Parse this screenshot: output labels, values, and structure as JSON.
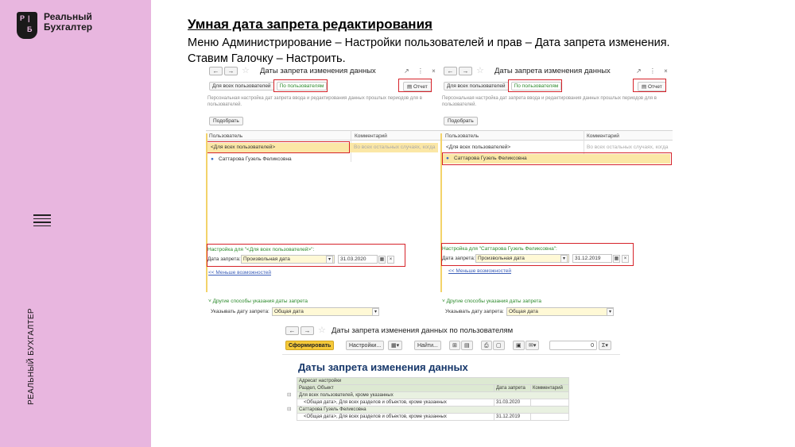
{
  "sidebar": {
    "logo_letters": [
      "Р",
      "Б"
    ],
    "logo_line1": "Реальный",
    "logo_line2": "Бухгалтер",
    "vertical_text": "РЕАЛЬНЫЙ БУХГАЛТЕР"
  },
  "heading": {
    "title": "Умная дата запрета редактирования",
    "line1": "Меню Администрирование – Настройки пользователей и прав – Дата запрета изменения.",
    "line2": "Ставим Галочку – Настроить."
  },
  "window_left": {
    "title": "Даты запрета изменения данных",
    "controls": "↗ ⋮ ×",
    "tab_all": "Для всех пользователей",
    "tab_by_user": "По пользователям",
    "report_btn": "Отчет",
    "description": "Персональная настройка дат запрета ввода и редактирования данных прошлых периодов для в пользователей.",
    "pick_btn": "Подобрать",
    "col_user": "Пользователь",
    "col_comment": "Комментарий",
    "row1_user": "<Для всех пользователей>",
    "row1_comment": "Во всех остальных случаях, когда",
    "row2_user": "Саттарова Гузель Феликсовна",
    "setting_label": "Настройка для \"<Для всех пользователей>\":",
    "date_label": "Дата запрета:",
    "date_type": "Произвольная дата",
    "date_value": "31.03.2020",
    "less_link": "<< Меньше возможностей",
    "other_ways": "Другие способы указания даты запрета",
    "specify_label": "Указывать дату запрета:",
    "specify_value": "Общая дата"
  },
  "window_right": {
    "title": "Даты запрета изменения данных",
    "controls": "↗ ⋮ ×",
    "tab_all": "Для всех пользователей",
    "tab_by_user": "По пользователям",
    "report_btn": "Отчет",
    "description": "Персональная настройка дат запрета ввода и редактирования данных прошлых периодов для в пользователей.",
    "pick_btn": "Подобрать",
    "col_user": "Пользователь",
    "col_comment": "Комментарий",
    "row1_user": "<Для всех пользователей>",
    "row1_comment": "Во всех остальных случаях, когда",
    "row2_user": "Саттарова Гузель Феликсовна",
    "setting_label": "Настройка для \"Саттарова Гузель Феликсовна\":",
    "date_label": "Дата запрета:",
    "date_type": "Произвольная дата",
    "date_value": "31.12.2019",
    "less_link": "<< Меньше возможностей",
    "other_ways": "Другие способы указания даты запрета",
    "specify_label": "Указывать дату запрета:",
    "specify_value": "Общая дата"
  },
  "report_window": {
    "title": "Даты запрета изменения данных по пользователям",
    "generate_btn": "Сформировать",
    "settings_btn": "Настройки...",
    "find_btn": "Найти...",
    "sum_value": "0",
    "report_title": "Даты запрета изменения данных",
    "h_addressee": "Адресат настройки",
    "h_section": "Раздел, Объект",
    "h_date": "Дата запрета",
    "h_comment": "Комментарий",
    "group1": "Для всех пользователей, кроме указанных",
    "group1_item": "<Общая дата>, Для всех разделов и объектов, кроме указанных",
    "group1_date": "31.03.2020",
    "group2": "Саттарова Гузель Феликсовна",
    "group2_item": "<Общая дата>, Для всех разделов и объектов, кроме указанных",
    "group2_date": "31.12.2019"
  },
  "colors": {
    "sidebar_bg": "#e8b6df",
    "highlight_red": "#d6232a",
    "row_yellow": "#fbe7a6",
    "link_green": "#2c8a2c"
  }
}
